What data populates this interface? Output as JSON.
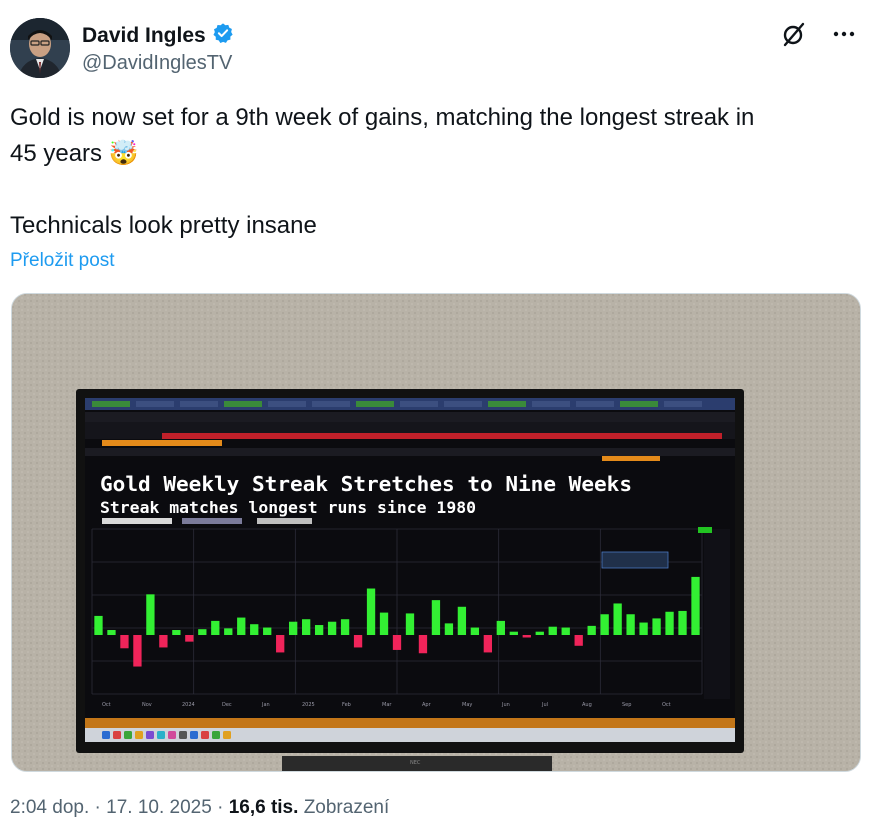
{
  "author": {
    "name": "David Ingles",
    "handle": "@DavidInglesTV",
    "verified": true
  },
  "tweet": {
    "line1": "Gold is now set for a 9th week of gains, matching the longest streak in",
    "line2": "45 years",
    "emoji": "🤯",
    "line3": "Technicals look pretty insane",
    "translate_link": "Přeložit post"
  },
  "media": {
    "chart_title": "Gold Weekly Streak Stretches to Nine Weeks",
    "chart_subtitle": "Streak matches longest runs since 1980",
    "chart_data": {
      "type": "bar",
      "title": "Gold Weekly Streak Stretches to Nine Weeks",
      "subtitle": "Streak matches longest runs since 1980",
      "x_labels": [
        "Oct",
        "Nov",
        "2024",
        "Dec",
        "Jan",
        "2025",
        "Feb",
        "Mar",
        "Apr",
        "May",
        "Jun",
        "Jul",
        "Aug",
        "Sep",
        "Oct"
      ],
      "values": [
        2.3,
        0.6,
        -1.6,
        -3.8,
        4.9,
        -1.5,
        0.6,
        -0.8,
        0.7,
        1.7,
        0.8,
        2.1,
        1.3,
        0.9,
        -2.1,
        1.6,
        1.9,
        1.2,
        1.6,
        1.9,
        -1.5,
        5.6,
        2.7,
        -1.8,
        2.6,
        -2.2,
        4.2,
        1.4,
        3.4,
        0.9,
        -2.1,
        1.7,
        0.4,
        -0.3,
        0.4,
        1.0,
        0.9,
        -1.3,
        1.1,
        2.5,
        3.8,
        2.5,
        1.5,
        2.0,
        2.8,
        2.9,
        7.0
      ]
    }
  },
  "meta": {
    "time": "2:04 dop.",
    "date": "17. 10. 2025",
    "views_count": "16,6 tis.",
    "views_label": "Zobrazení"
  }
}
